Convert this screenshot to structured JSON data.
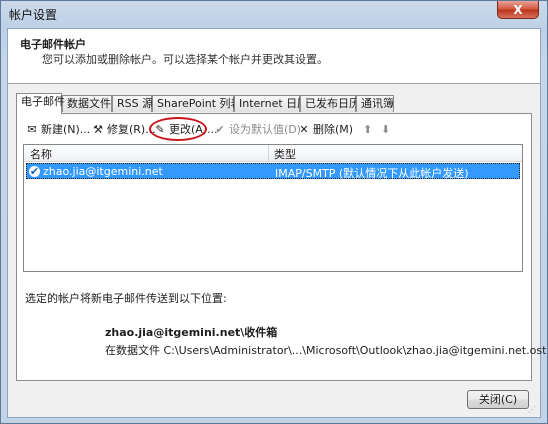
{
  "window": {
    "title": "帐户设置",
    "close_glyph": "X"
  },
  "header": {
    "title": "电子邮件帐户",
    "description": "您可以添加或删除帐户。可以选择某个帐户并更改其设置。"
  },
  "tabs": [
    {
      "label": "电子邮件"
    },
    {
      "label": "数据文件"
    },
    {
      "label": "RSS 源"
    },
    {
      "label": "SharePoint 列表"
    },
    {
      "label": "Internet 日历"
    },
    {
      "label": "已发布日历"
    },
    {
      "label": "通讯簿"
    }
  ],
  "toolbar": {
    "new_label": "新建(N)...",
    "repair_label": "修复(R)...",
    "change_label": "更改(A)...",
    "set_default_label": "设为默认值(D)",
    "remove_label": "删除(M)",
    "up_glyph": "⬆",
    "down_glyph": "⬇",
    "highlight_color": "#c8161c"
  },
  "account_list": {
    "columns": [
      "名称",
      "类型"
    ],
    "rows": [
      {
        "name": "zhao.jia@itgemini.net",
        "type": "IMAP/SMTP (默认情况下从此帐户发送)",
        "default": true
      }
    ],
    "selected_color": "#3399ff"
  },
  "delivery": {
    "note": "选定的帐户将新电子邮件传送到以下位置:",
    "destination": "zhao.jia@itgemini.net\\收件箱",
    "path": "在数据文件 C:\\Users\\Administrator\\...\\Microsoft\\Outlook\\zhao.jia@itgemini.net.ost 中"
  },
  "footer": {
    "close_label": "关闭(C)"
  }
}
